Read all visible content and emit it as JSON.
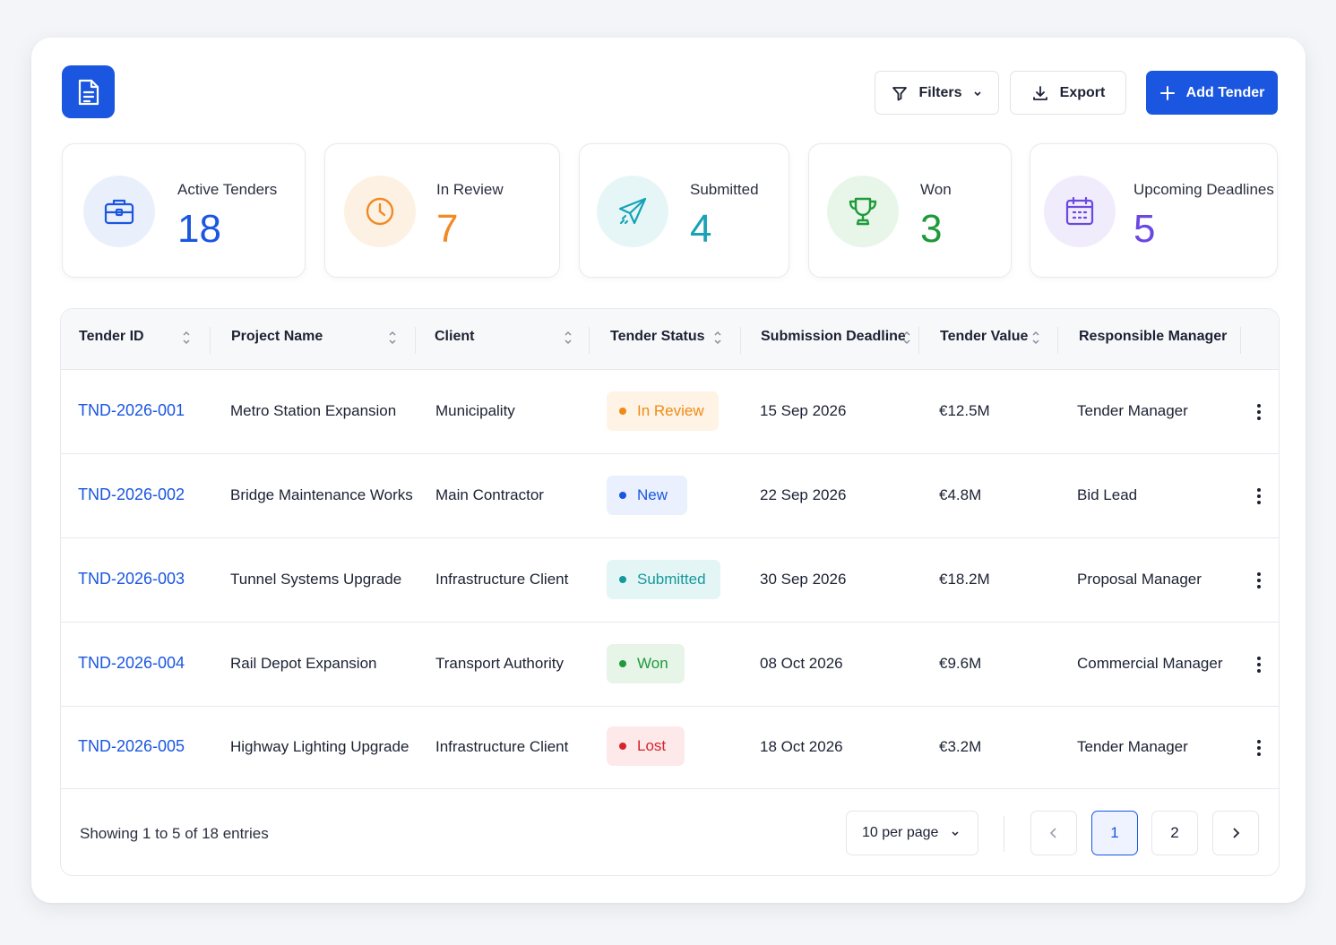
{
  "header": {
    "filters_label": "Filters",
    "export_label": "Export",
    "add_label": "Add Tender"
  },
  "stats": [
    {
      "label": "Active Tenders",
      "value": "18",
      "icon": "briefcase-icon",
      "color": "#1a56e0",
      "bg": "#eaf0fb"
    },
    {
      "label": "In Review",
      "value": "7",
      "icon": "clock-icon",
      "color": "#f08a24",
      "bg": "#fdf1e3"
    },
    {
      "label": "Submitted",
      "value": "4",
      "icon": "paper-plane-icon",
      "color": "#17a2b8",
      "bg": "#e6f6f7"
    },
    {
      "label": "Won",
      "value": "3",
      "icon": "trophy-icon",
      "color": "#1f9a3a",
      "bg": "#e8f6ea"
    },
    {
      "label": "Upcoming Deadlines",
      "value": "5",
      "icon": "calendar-icon",
      "color": "#6b48e0",
      "bg": "#f0ecfc"
    }
  ],
  "table": {
    "columns": [
      "Tender ID",
      "Project Name",
      "Client",
      "Tender Status",
      "Submission Deadline",
      "Tender Value",
      "Responsible Manager"
    ],
    "rows": [
      {
        "id": "TND-2026-001",
        "project": "Metro Station Expansion",
        "client": "Municipality",
        "status": "In Review",
        "deadline": "15 Sep 2026",
        "value": "€12.5M",
        "manager": "Tender Manager"
      },
      {
        "id": "TND-2026-002",
        "project": "Bridge Maintenance Works",
        "client": "Main Contractor",
        "status": "New",
        "deadline": "22 Sep 2026",
        "value": "€4.8M",
        "manager": "Bid Lead"
      },
      {
        "id": "TND-2026-003",
        "project": "Tunnel Systems Upgrade",
        "client": "Infrastructure Client",
        "status": "Submitted",
        "deadline": "30 Sep 2026",
        "value": "€18.2M",
        "manager": "Proposal Manager"
      },
      {
        "id": "TND-2026-004",
        "project": "Rail Depot Expansion",
        "client": "Transport Authority",
        "status": "Won",
        "deadline": "08 Oct 2026",
        "value": "€9.6M",
        "manager": "Commercial Manager"
      },
      {
        "id": "TND-2026-005",
        "project": "Highway Lighting Upgrade",
        "client": "Infrastructure Client",
        "status": "Lost",
        "deadline": "18 Oct 2026",
        "value": "€3.2M",
        "manager": "Tender Manager"
      }
    ],
    "status_colors": {
      "In Review": {
        "fg": "#ef8a16",
        "bg": "#fef3e4"
      },
      "New": {
        "fg": "#1a56e0",
        "bg": "#eaf0fd"
      },
      "Submitted": {
        "fg": "#15989c",
        "bg": "#e4f5f5"
      },
      "Won": {
        "fg": "#1f9a3a",
        "bg": "#e7f5e9"
      },
      "Lost": {
        "fg": "#d6242b",
        "bg": "#fde9ea"
      }
    }
  },
  "footer": {
    "showing": "Showing 1 to 5 of 18 entries",
    "per_page": "10 per page",
    "pages": [
      "1",
      "2"
    ],
    "current_page": "1"
  }
}
